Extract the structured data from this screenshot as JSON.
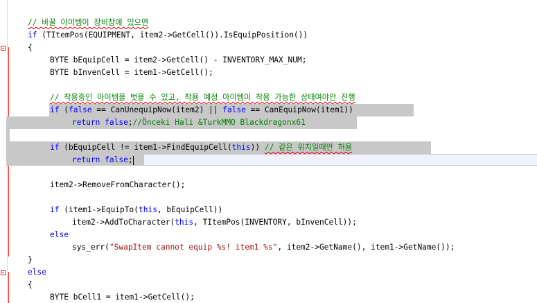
{
  "editor": {
    "language": "C++",
    "colors": {
      "keyword": "#0000ff",
      "comment": "#008000",
      "string": "#a31515",
      "selection": "#c8c8c8",
      "current_line": "#f2f2ff",
      "error_squiggle": "#e00000"
    },
    "lines": [
      {
        "indent": "    ",
        "text": "// 바꿀 아이템이 장비창에 있으면"
      },
      {
        "indent": "    ",
        "p": [
          "if",
          " (TItemPos(EQUIPMENT, item2->GetCell()).IsEquipPosition())"
        ]
      },
      {
        "indent": "    ",
        "text": "{"
      },
      {
        "indent": "        ",
        "text": "BYTE bEquipCell = item2->GetCell() - INVENTORY_MAX_NUM;"
      },
      {
        "indent": "        ",
        "text": "BYTE bInvenCell = item1->GetCell();"
      },
      {
        "indent": "",
        "text": ""
      },
      {
        "indent": "        ",
        "text": "// 착용중인 아이템을 벗을 수 있고, 착용 예정 아이템이 착용 가능한 상태여야만 진행"
      },
      {
        "indent": "        ",
        "p": [
          "if",
          " (",
          "false",
          " == CanUnequipNow(item2) || ",
          "false",
          " == CanEquipNow(item1))"
        ]
      },
      {
        "indent": "            ",
        "p": [
          "return",
          " ",
          "false",
          ";",
          "//Önceki Hali &TurkMMO Blackdragonx61"
        ]
      },
      {
        "indent": "",
        "text": ""
      },
      {
        "indent": "        ",
        "p": [
          "if",
          " (bEquipCell != item1->FindEquipCell(",
          "this",
          ")) ",
          "// 같은 위치일때만 허용"
        ]
      },
      {
        "indent": "            ",
        "p": [
          "return",
          " ",
          "false",
          ";"
        ]
      },
      {
        "indent": "",
        "text": ""
      },
      {
        "indent": "        ",
        "text": "item2->RemoveFromCharacter();"
      },
      {
        "indent": "",
        "text": ""
      },
      {
        "indent": "        ",
        "p": [
          "if",
          " (item1->EquipTo(",
          "this",
          ", bEquipCell))"
        ]
      },
      {
        "indent": "            ",
        "p": [
          "item2->AddToCharacter(",
          "this",
          ", TItemPos(INVENTORY, bInvenCell));"
        ]
      },
      {
        "indent": "        ",
        "text": "else"
      },
      {
        "indent": "            ",
        "p": [
          "sys_err(",
          "\"SwapItem cannot equip %s! item1 %s\"",
          ", item2->GetName(), item1->GetName());"
        ]
      },
      {
        "indent": "    ",
        "text": "}"
      },
      {
        "indent": "    ",
        "text": "else"
      },
      {
        "indent": "    ",
        "text": "{"
      },
      {
        "indent": "        ",
        "text": "BYTE bCell1 = item1->GetCell();"
      }
    ]
  }
}
